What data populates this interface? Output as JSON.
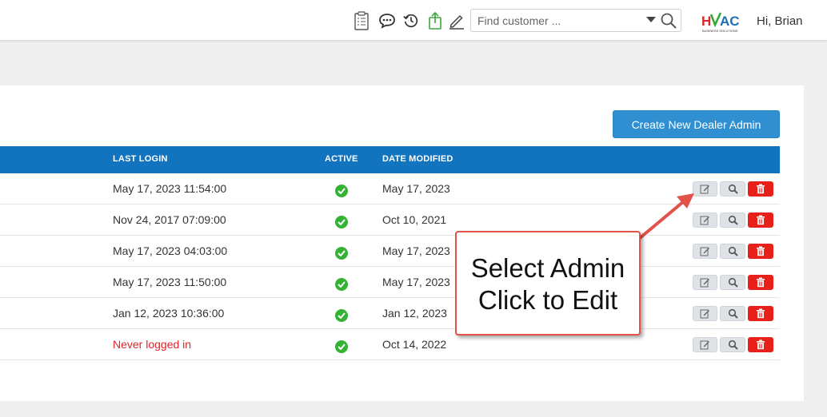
{
  "header": {
    "search": {
      "placeholder": "Find customer ...",
      "value": ""
    },
    "greeting": "Hi, Brian",
    "logo_text": "HVAC BUSINESS SOLUTIONS",
    "icons": [
      "clipboard-icon",
      "chat-icon",
      "history-icon",
      "upload-icon",
      "edit-pencil-icon"
    ]
  },
  "actions": {
    "create_label": "Create New Dealer Admin"
  },
  "table": {
    "columns": [
      "LAST LOGIN",
      "ACTIVE",
      "DATE MODIFIED"
    ],
    "rows": [
      {
        "last_login": "May 17, 2023 11:54:00",
        "active": true,
        "date_modified": "May 17, 2023"
      },
      {
        "last_login": "Nov 24, 2017 07:09:00",
        "active": true,
        "date_modified": "Oct 10, 2021"
      },
      {
        "last_login": "May 17, 2023 04:03:00",
        "active": true,
        "date_modified": "May 17, 2023"
      },
      {
        "last_login": "May 17, 2023 11:50:00",
        "active": true,
        "date_modified": "May 17, 2023"
      },
      {
        "last_login": "Jan 12, 2023 10:36:00",
        "active": true,
        "date_modified": "Jan 12, 2023"
      },
      {
        "last_login": "Never logged in",
        "active": true,
        "date_modified": "Oct 14, 2022"
      }
    ]
  },
  "callout": {
    "line1": "Select Admin",
    "line2": "Click to Edit"
  },
  "colors": {
    "header_blue": "#1274bf",
    "button_blue": "#2f8fd0",
    "delete_red": "#e8201a",
    "active_green": "#33b233",
    "never_red": "#e0242a"
  }
}
